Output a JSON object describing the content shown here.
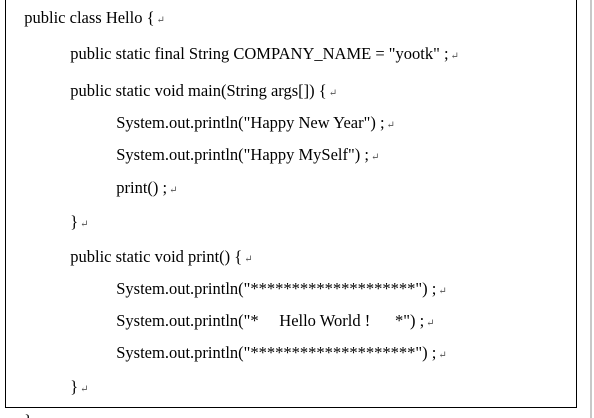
{
  "document": {
    "mark": "↵",
    "lines": [
      {
        "text": "public class Hello {"
      },
      {
        "text": "public static final String COMPANY_NAME = \"yootk\" ;"
      },
      {
        "text": "public static void main(String args[]) {"
      },
      {
        "text": "System.out.println(\"Happy New Year\") ;"
      },
      {
        "text": "System.out.println(\"Happy MySelf\") ;"
      },
      {
        "text": "print() ;"
      },
      {
        "text": "}"
      },
      {
        "text": "public static void print() {"
      },
      {
        "text": "System.out.println(\"********************\") ;"
      },
      {
        "text": "System.out.println(\"*     Hello World !      *\") ;"
      },
      {
        "text": "System.out.println(\"********************\") ;"
      },
      {
        "text": "}"
      },
      {
        "text": "}"
      }
    ]
  }
}
